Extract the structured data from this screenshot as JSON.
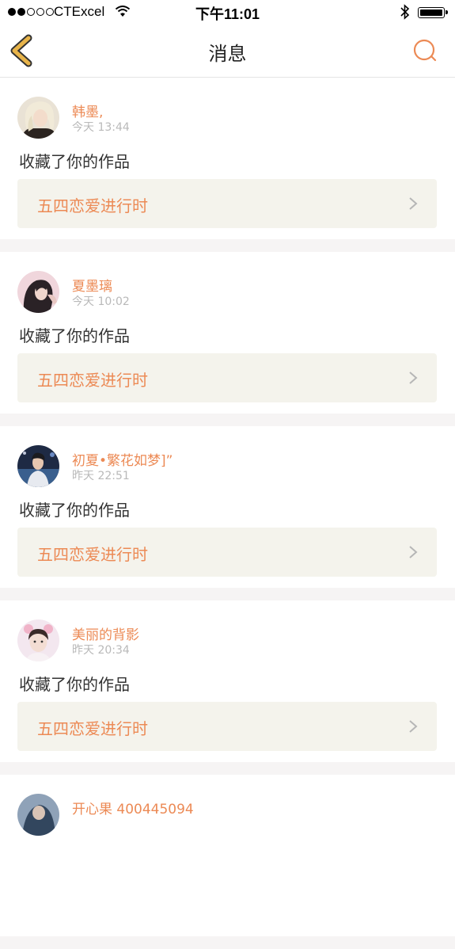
{
  "status_bar": {
    "carrier": "CTExcel",
    "time": "下午11:01"
  },
  "nav": {
    "title": "消息"
  },
  "colors": {
    "accent": "#ec8a55",
    "back_icon": "#e8b44a",
    "card_link_bg": "#f4f3ec",
    "separator": "#f6f4f4"
  },
  "messages": [
    {
      "username": "韩墨,",
      "timestamp": "今天 13:44",
      "action": "收藏了你的作品",
      "work_title": "五四恋爱进行时",
      "avatar_icon": "avatar-photo"
    },
    {
      "username": "夏墨璃",
      "timestamp": "今天 10:02",
      "action": "收藏了你的作品",
      "work_title": "五四恋爱进行时",
      "avatar_icon": "avatar-photo"
    },
    {
      "username": "初夏•繁花如梦]”",
      "timestamp": "昨天 22:51",
      "action": "收藏了你的作品",
      "work_title": "五四恋爱进行时",
      "avatar_icon": "avatar-photo"
    },
    {
      "username": "美丽的背影",
      "timestamp": "昨天 20:34",
      "action": "收藏了你的作品",
      "work_title": "五四恋爱进行时",
      "avatar_icon": "avatar-photo"
    },
    {
      "username": "开心果 400445094",
      "timestamp": "",
      "action": "",
      "work_title": "",
      "avatar_icon": "avatar-photo"
    }
  ]
}
